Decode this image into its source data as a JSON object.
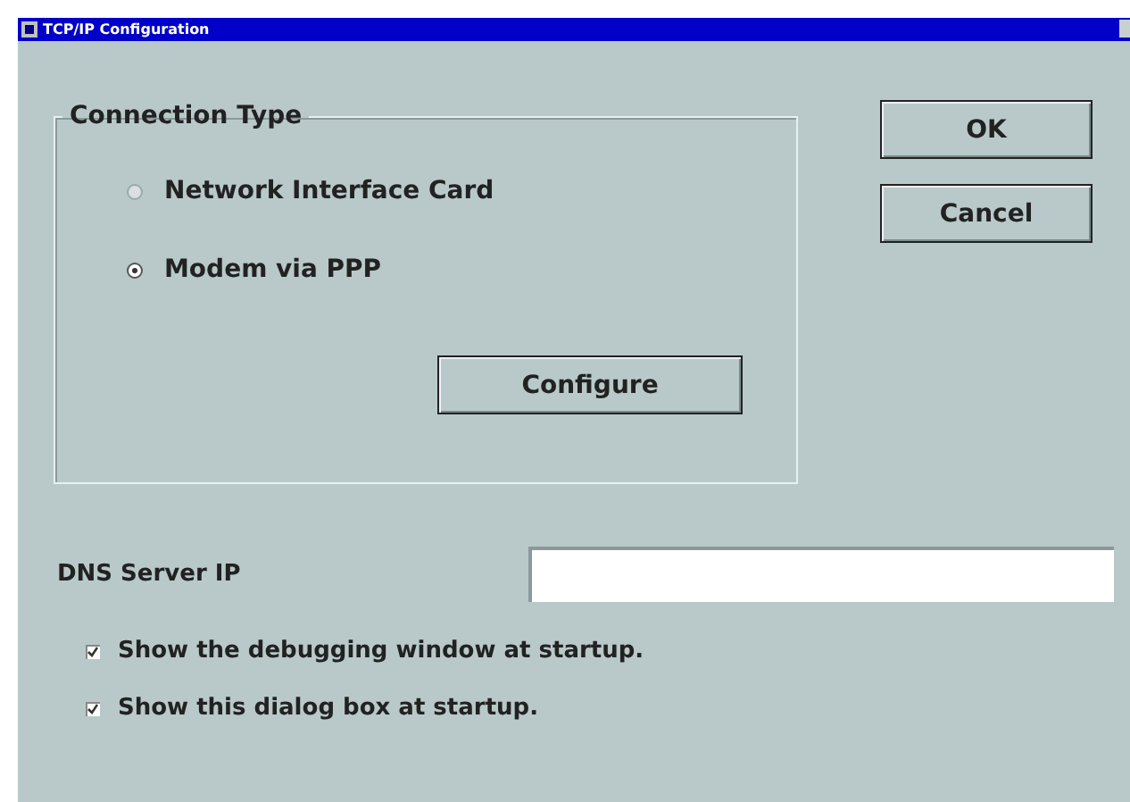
{
  "window": {
    "title": "TCP/IP Configuration"
  },
  "connection_type": {
    "title": "Connection Type",
    "options": [
      {
        "label": "Network Interface Card",
        "selected": false
      },
      {
        "label": "Modem via PPP",
        "selected": true
      }
    ],
    "configure_button": "Configure"
  },
  "buttons": [
    "OK",
    "Cancel"
  ],
  "dns": {
    "label": "DNS Server IP"
  },
  "checkboxes": [
    {
      "label": "Show the debugging window at startup.",
      "checked": true
    },
    {
      "label": "Show this dialog box at startup.",
      "checked": true
    }
  ]
}
